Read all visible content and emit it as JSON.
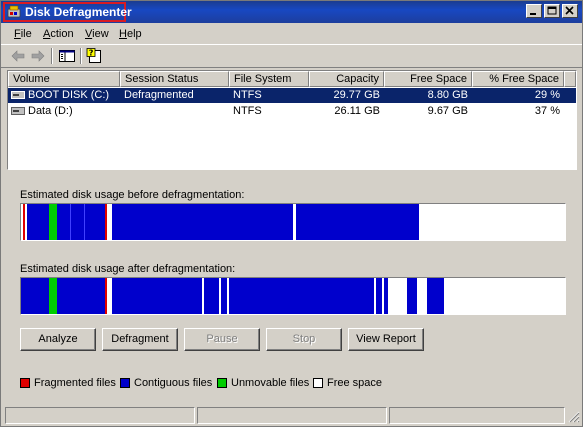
{
  "window": {
    "title": "Disk Defragmenter"
  },
  "menu": {
    "file": {
      "underline": "F",
      "rest": "ile"
    },
    "action": {
      "underline": "A",
      "rest": "ction"
    },
    "view": {
      "underline": "V",
      "rest": "iew"
    },
    "help": {
      "underline": "H",
      "rest": "elp"
    }
  },
  "toolbar": {
    "icons": [
      "back-arrow-icon",
      "forward-arrow-icon",
      "show-hide-console-tree-icon",
      "help-icon"
    ]
  },
  "volumes": {
    "columns": [
      "Volume",
      "Session Status",
      "File System",
      "Capacity",
      "Free Space",
      "% Free Space"
    ],
    "rows": [
      {
        "volume": "BOOT DISK (C:)",
        "status": "Defragmented",
        "fs": "NTFS",
        "capacity": "29.77 GB",
        "free": "8.80 GB",
        "pct": "29 %",
        "selected": true
      },
      {
        "volume": "Data (D:)",
        "status": "",
        "fs": "NTFS",
        "capacity": "26.11 GB",
        "free": "9.67 GB",
        "pct": "37 %",
        "selected": false
      }
    ]
  },
  "analysis": {
    "before_label": "Estimated disk usage before defragmentation:",
    "after_label": "Estimated disk usage after defragmentation:"
  },
  "buttons": {
    "analyze": "Analyze",
    "defragment": "Defragment",
    "pause": "Pause",
    "stop": "Stop",
    "view_report": "View Report"
  },
  "legend": {
    "fragmented": "Fragmented files",
    "contiguous": "Contiguous files",
    "unmovable": "Unmovable files",
    "free": "Free space"
  },
  "colors": {
    "fragmented": "#e00000",
    "contiguous": "#0000cc",
    "unmovable": "#00cc00",
    "free": "#ffffff",
    "selection": "#0a246a",
    "titlebar": "#1848c2"
  }
}
